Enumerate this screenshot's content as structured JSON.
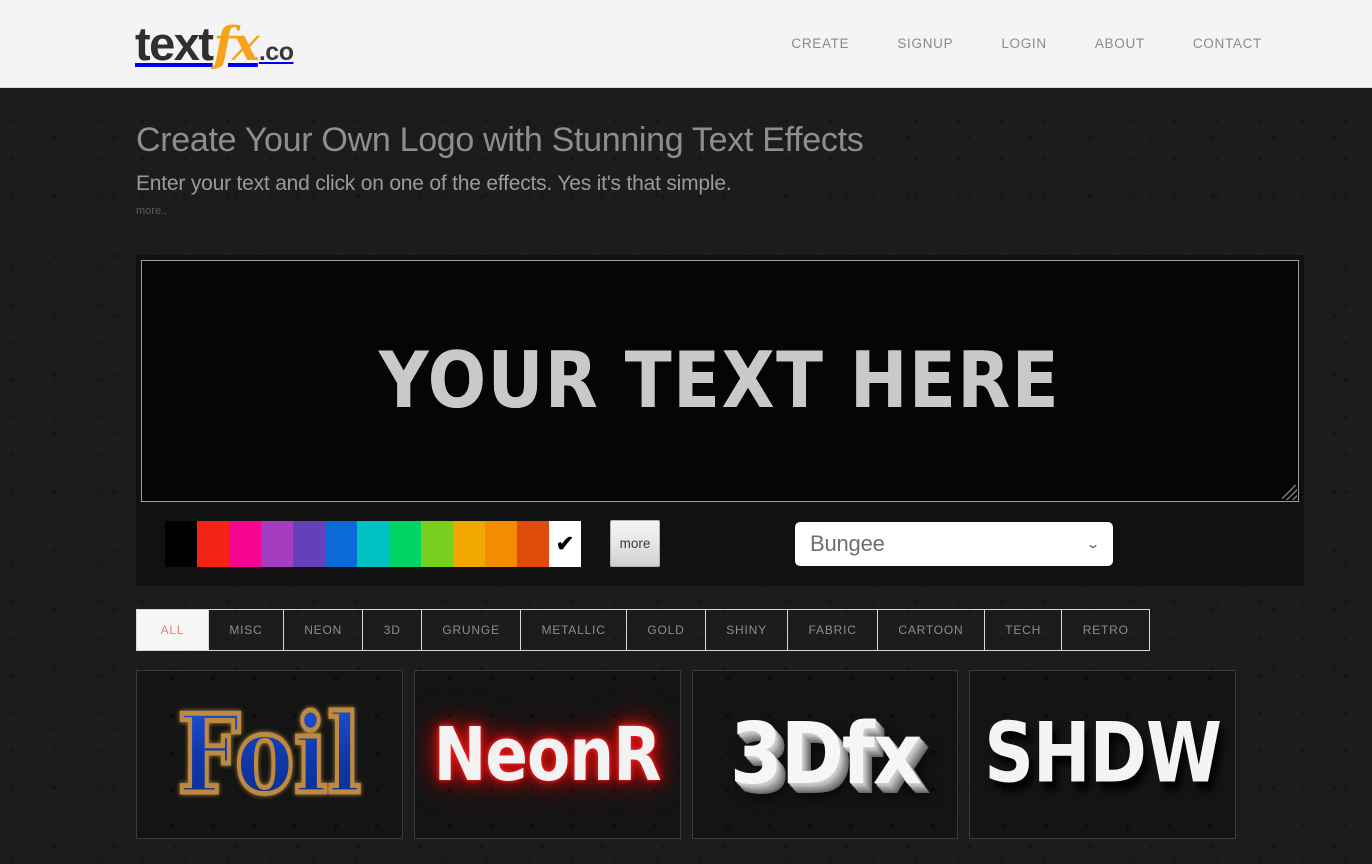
{
  "header": {
    "logo": {
      "part1": "text",
      "part2": "fx",
      "part3": ".co"
    },
    "nav": [
      {
        "label": "CREATE"
      },
      {
        "label": "SIGNUP"
      },
      {
        "label": "LOGIN"
      },
      {
        "label": "ABOUT"
      },
      {
        "label": "CONTACT"
      }
    ]
  },
  "hero": {
    "title": "Create Your Own Logo with Stunning Text Effects",
    "subtitle": "Enter your text and click on one of the effects. Yes it's that simple.",
    "more_link": "more.."
  },
  "editor": {
    "canvas_text": "YOUR TEXT HERE",
    "colors": [
      {
        "name": "black",
        "hex": "#000000"
      },
      {
        "name": "red",
        "hex": "#f52314"
      },
      {
        "name": "magenta",
        "hex": "#f5058f"
      },
      {
        "name": "purple",
        "hex": "#a33cbf"
      },
      {
        "name": "violet",
        "hex": "#6441bb"
      },
      {
        "name": "blue",
        "hex": "#0a6bd8"
      },
      {
        "name": "cyan",
        "hex": "#00c2c2"
      },
      {
        "name": "green",
        "hex": "#00d464"
      },
      {
        "name": "light-green",
        "hex": "#77d01e"
      },
      {
        "name": "amber",
        "hex": "#f0a800"
      },
      {
        "name": "orange",
        "hex": "#f58b00"
      },
      {
        "name": "dark-orange",
        "hex": "#e04a0a"
      },
      {
        "name": "white",
        "hex": "#ffffff",
        "selected": true,
        "check": "✔"
      }
    ],
    "more_colors_label": "more",
    "font_select": {
      "value": "Bungee",
      "chevron": "⌄"
    }
  },
  "tabs": [
    {
      "label": "ALL",
      "active": true
    },
    {
      "label": "MISC"
    },
    {
      "label": "NEON"
    },
    {
      "label": "3D"
    },
    {
      "label": "GRUNGE"
    },
    {
      "label": "METALLIC"
    },
    {
      "label": "GOLD"
    },
    {
      "label": "SHINY"
    },
    {
      "label": "FABRIC"
    },
    {
      "label": "CARTOON"
    },
    {
      "label": "TECH"
    },
    {
      "label": "RETRO"
    }
  ],
  "effects": [
    {
      "label": "Foil",
      "style": "foil"
    },
    {
      "label": "NeonR",
      "style": "neon"
    },
    {
      "label": "3Dfx",
      "style": "3d"
    },
    {
      "label": "SHDW",
      "style": "shdw"
    }
  ]
}
